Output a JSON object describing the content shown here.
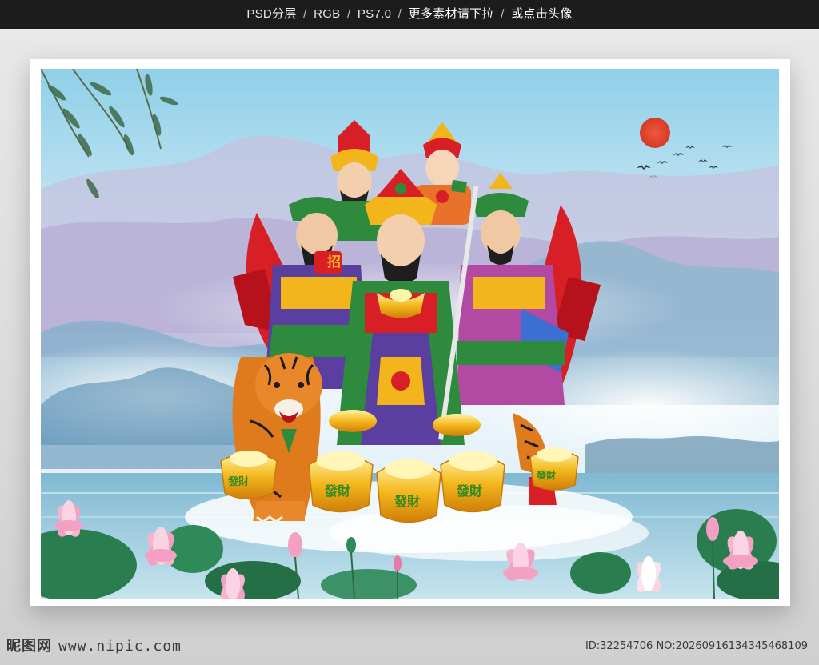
{
  "header": {
    "format": "PSD分层",
    "mode": "RGB",
    "version": "PS7.0",
    "cta": "更多素材请下拉",
    "cta2": "或点击头像"
  },
  "artwork": {
    "ingot_text": "發財",
    "banner_char": "招",
    "colors": {
      "sky_top": "#9fd6ea",
      "sky_mid": "#d8eef7",
      "mountain": "#b9b2d6",
      "water": "#8fc4da",
      "sun": "#e2402a",
      "gold": "#f3b51c",
      "red": "#d91f26",
      "lotus": "#f4a0c3",
      "leaf": "#2a7d4f"
    }
  },
  "footer": {
    "brand": "昵图网",
    "site": "www.nipic.com",
    "id_text": "ID:32254706 NO:20260916134345468109"
  }
}
